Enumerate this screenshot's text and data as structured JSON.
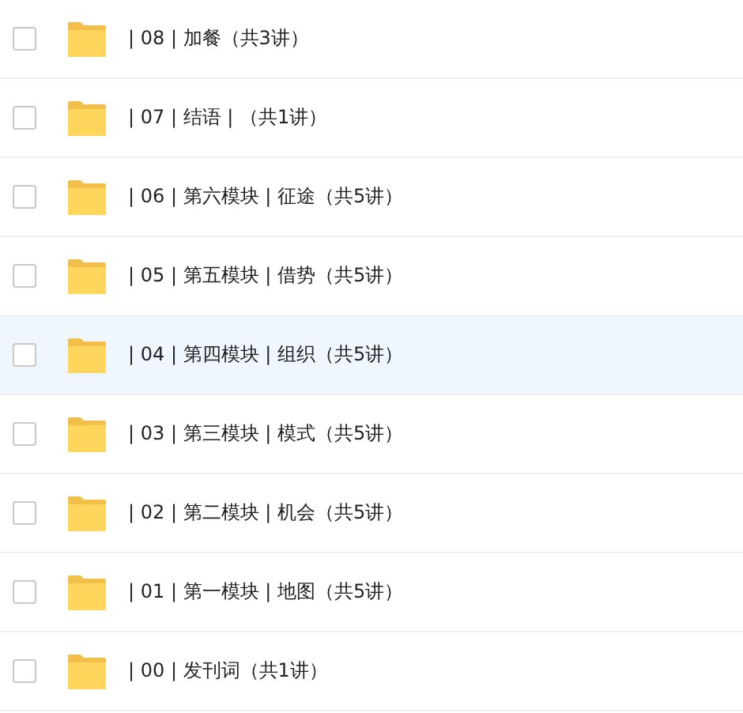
{
  "folders": [
    {
      "name": "| 08 | 加餐（共3讲）",
      "checked": false,
      "hovered": false
    },
    {
      "name": "| 07 | 结语 | （共1讲）",
      "checked": false,
      "hovered": false
    },
    {
      "name": "| 06 | 第六模块 | 征途（共5讲）",
      "checked": false,
      "hovered": false
    },
    {
      "name": "| 05 | 第五模块 | 借势（共5讲）",
      "checked": false,
      "hovered": false
    },
    {
      "name": "| 04 | 第四模块 | 组织（共5讲）",
      "checked": false,
      "hovered": true
    },
    {
      "name": "| 03 | 第三模块 | 模式（共5讲）",
      "checked": false,
      "hovered": false
    },
    {
      "name": "| 02 | 第二模块 | 机会（共5讲）",
      "checked": false,
      "hovered": false
    },
    {
      "name": "| 01 | 第一模块 | 地图（共5讲）",
      "checked": false,
      "hovered": false
    },
    {
      "name": "| 00 | 发刊词（共1讲）",
      "checked": false,
      "hovered": false
    }
  ]
}
